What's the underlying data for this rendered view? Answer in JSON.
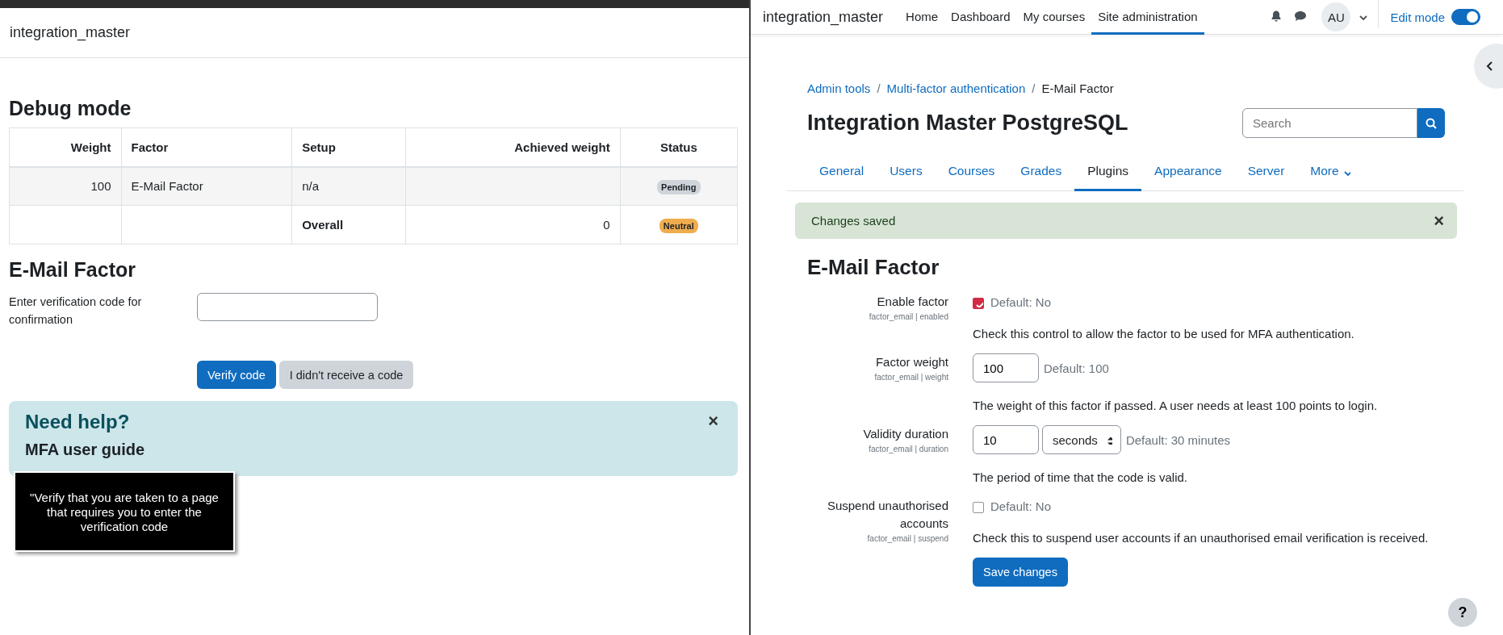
{
  "left_panel": {
    "site_name": "integration_master",
    "debug": {
      "title": "Debug mode",
      "columns": [
        "Weight",
        "Factor",
        "Setup",
        "Achieved weight",
        "Status"
      ],
      "rows": [
        {
          "kind": "factor",
          "cells": [
            "100",
            "E-Mail Factor",
            "n/a",
            ""
          ],
          "status": {
            "text": "Pending",
            "color": "#ced4da"
          }
        },
        {
          "kind": "total",
          "cells": [
            "",
            "",
            "Overall",
            "0"
          ],
          "status": {
            "text": "Neutral",
            "color": "#f0ad4e"
          }
        }
      ]
    },
    "form": {
      "title": "E-Mail Factor",
      "label": "Enter verification code for confirmation",
      "buttons": [
        {
          "label": "Verify code",
          "kind": "primary"
        },
        {
          "label": "I didn't receive a code",
          "kind": "secondary"
        }
      ]
    },
    "help": {
      "title": "Need help?",
      "link": "MFA user guide",
      "close": "×"
    },
    "tooltip": "\"Verify that you are taken to a page that requires you to enter the verification code"
  },
  "right_panel": {
    "site_name": "integration_master",
    "nav": [
      {
        "label": "Home",
        "selected": false
      },
      {
        "label": "Dashboard",
        "selected": false
      },
      {
        "label": "My courses",
        "selected": false
      },
      {
        "label": "Site administration",
        "selected": true
      }
    ],
    "avatar": "AU",
    "edit_mode": {
      "label": "Edit mode",
      "on": true
    },
    "breadcrumb": [
      {
        "label": "Admin tools",
        "kind": "link"
      },
      {
        "label": "/",
        "kind": "separator"
      },
      {
        "label": "Multi-factor authentication",
        "kind": "link"
      },
      {
        "label": "/",
        "kind": "separator"
      },
      {
        "label": "E-Mail Factor",
        "kind": "current"
      }
    ],
    "page_title": "Integration Master PostgreSQL",
    "search": {
      "placeholder": "Search"
    },
    "tabs": [
      {
        "label": "General",
        "selected": false
      },
      {
        "label": "Users",
        "selected": false
      },
      {
        "label": "Courses",
        "selected": false
      },
      {
        "label": "Grades",
        "selected": false
      },
      {
        "label": "Plugins",
        "selected": true
      },
      {
        "label": "Appearance",
        "selected": false
      },
      {
        "label": "Server",
        "selected": false
      },
      {
        "label": "More",
        "selected": false,
        "dropdown": true
      }
    ],
    "alert": {
      "text": "Changes saved",
      "close": "×"
    },
    "section_title": "E-Mail Factor",
    "settings": [
      {
        "kind": "checkbox",
        "label": "Enable factor",
        "key": "factor_email | enabled",
        "checked": true,
        "default": "Default: No",
        "description": "Check this control to allow the factor to be used for MFA authentication."
      },
      {
        "kind": "text",
        "label": "Factor weight",
        "key": "factor_email | weight",
        "value": "100",
        "default": "Default: 100",
        "description": "The weight of this factor if passed. A user needs at least 100 points to login."
      },
      {
        "kind": "duration",
        "label": "Validity duration",
        "key": "factor_email | duration",
        "value": "10",
        "unit": "seconds",
        "default": "Default: 30 minutes",
        "description": "The period of time that the code is valid."
      },
      {
        "kind": "checkbox",
        "label": "Suspend unauthorised accounts",
        "key": "factor_email | suspend",
        "checked": false,
        "default": "Default: No",
        "description": "Check this to suspend user accounts if an unauthorised email verification is received."
      }
    ],
    "save_button": "Save changes",
    "help_button": "?"
  }
}
